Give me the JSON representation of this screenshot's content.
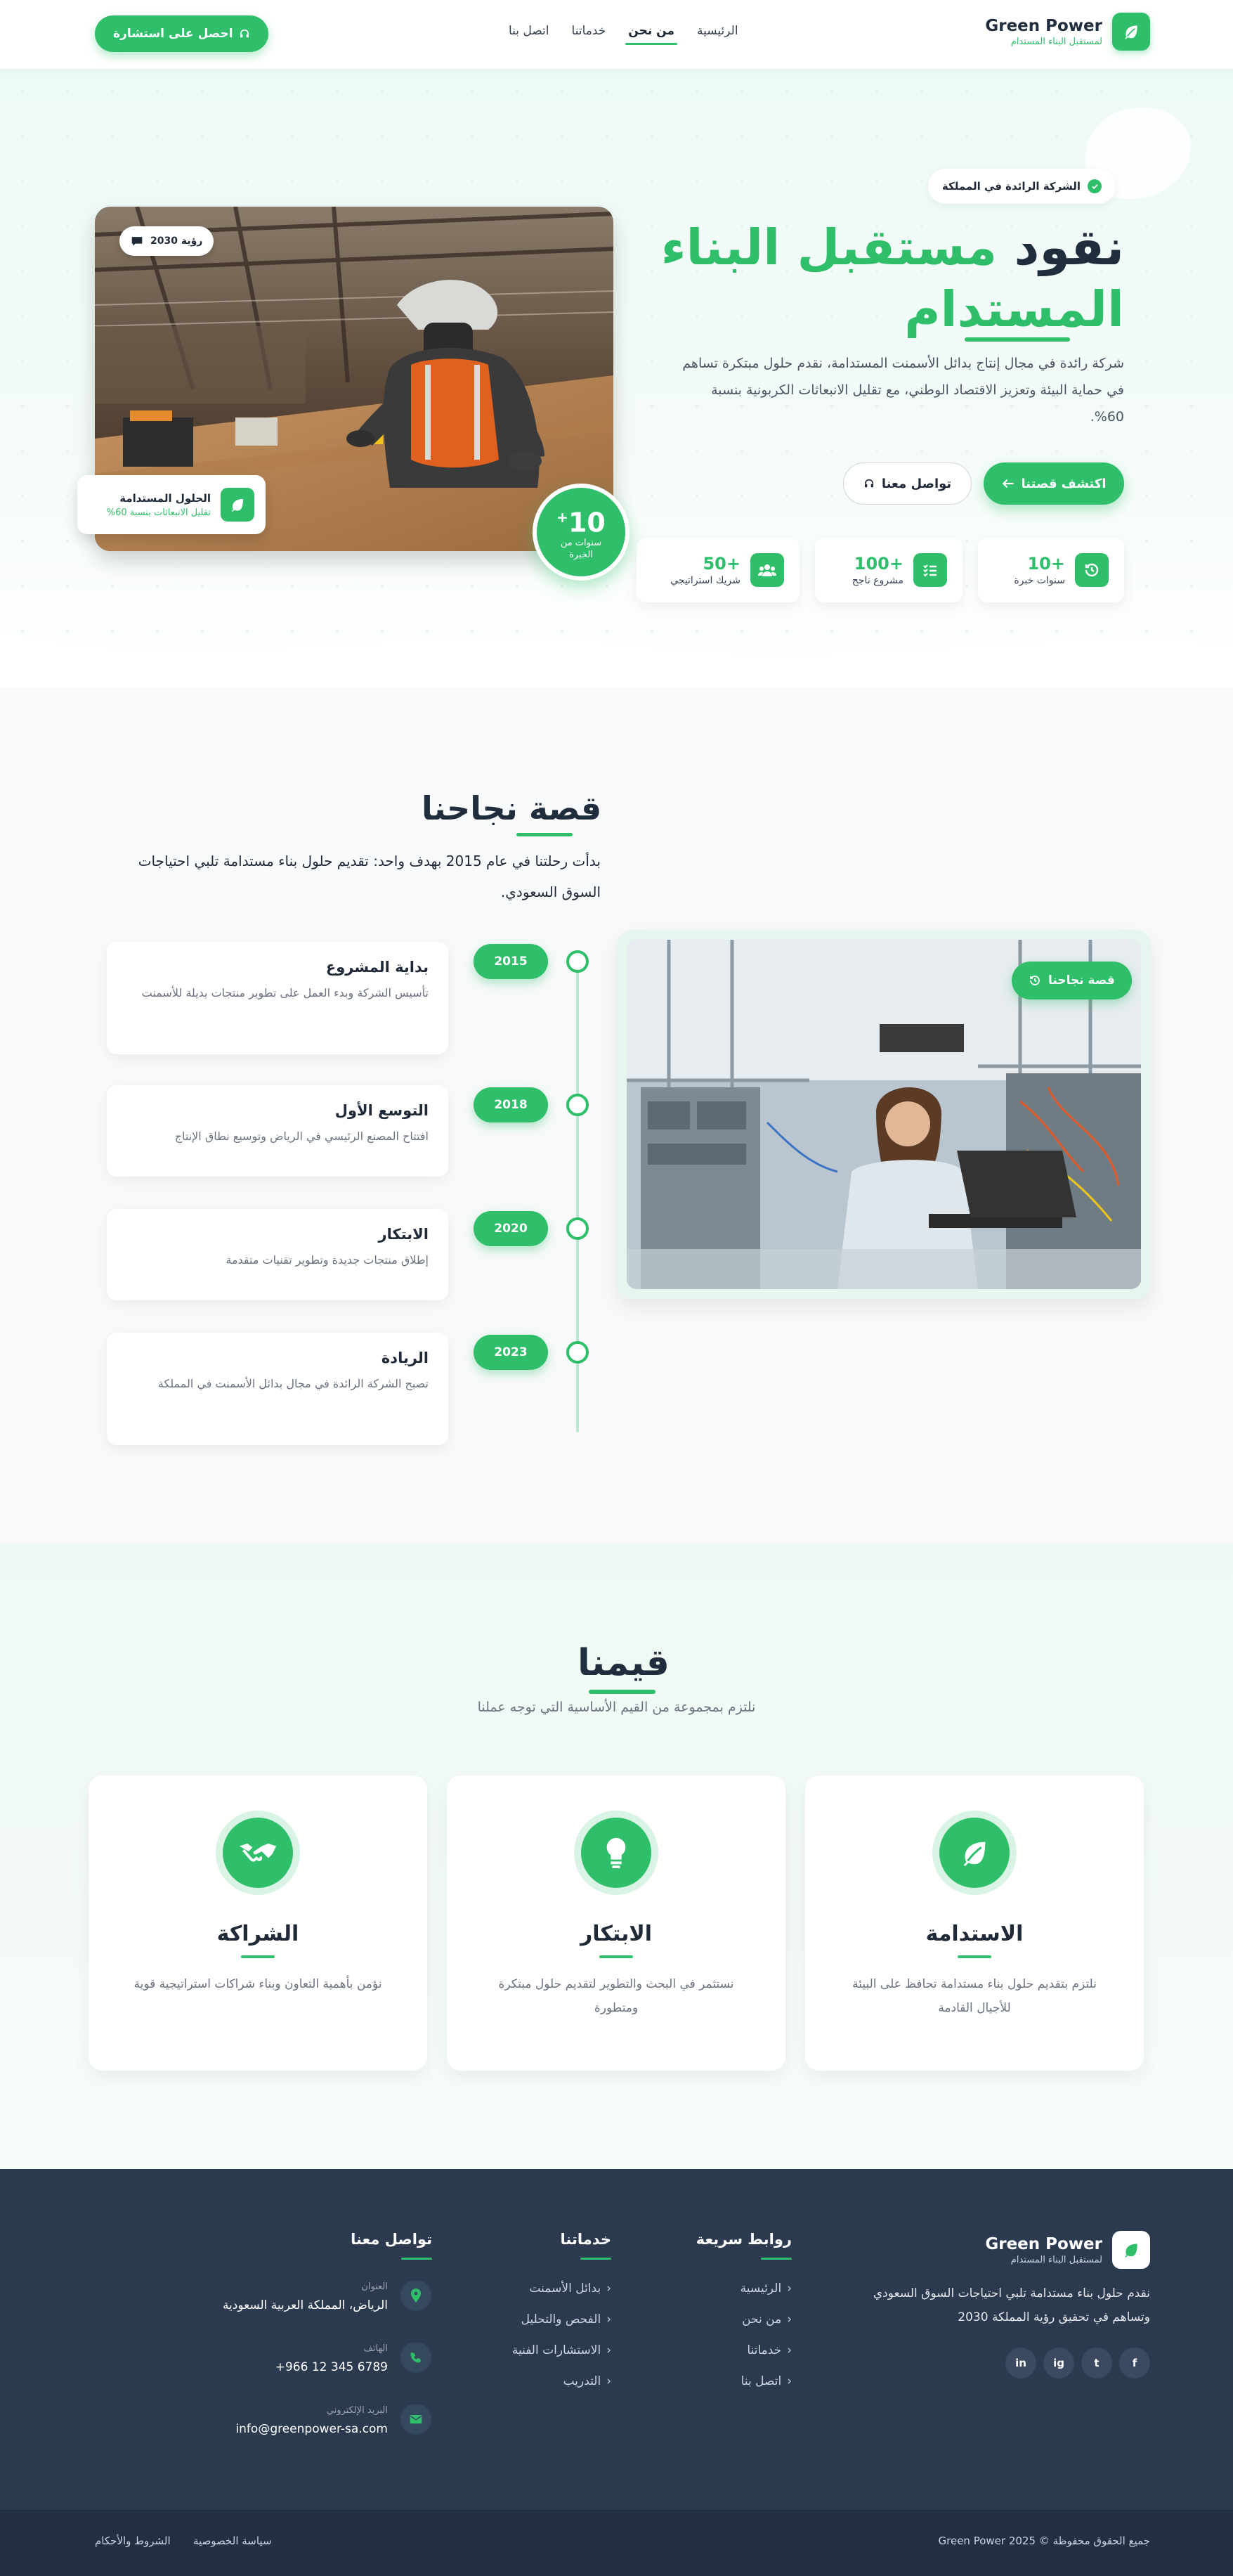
{
  "brand": {
    "name": "Green Power",
    "tagline": "لمستقبل البناء المستدام"
  },
  "nav": {
    "links": [
      "الرئيسية",
      "من نحن",
      "خدماتنا",
      "اتصل بنا"
    ],
    "active_index": 1,
    "cta": "احصل على استشارة"
  },
  "hero": {
    "badge": "الشركة الرائدة في المملكة",
    "title_line1_dark": "نقود",
    "title_line1_green": "مستقبل البناء",
    "title_line2_green": "المستدام",
    "description": "شركة رائدة في مجال إنتاج بدائل الأسمنت المستدامة، نقدم حلول مبتكرة تساهم في حماية البيئة وتعزيز الاقتصاد الوطني، مع تقليل الانبعاثات الكربونية بنسبة 60%.",
    "btn_primary": "اكتشف قصتنا",
    "btn_secondary": "تواصل معنا",
    "stats": [
      {
        "num": "+10",
        "label": "سنوات خبرة",
        "icon": "history-icon"
      },
      {
        "num": "+100",
        "label": "مشروع ناجح",
        "icon": "tasks-icon"
      },
      {
        "num": "+50",
        "label": "شريك استراتيجي",
        "icon": "users-icon"
      }
    ],
    "image_tag": "رؤية 2030",
    "mini_card": {
      "title": "الحلول المستدامة",
      "sub": "تقليل الانبعاثات بنسبة 60%"
    },
    "years_badge": {
      "num": "10",
      "sup": "+",
      "label": "سنوات من الخبرة"
    }
  },
  "story": {
    "title": "قصة نجاحنا",
    "description": "بدأت رحلتنا في عام 2015 بهدف واحد: تقديم حلول بناء مستدامة تلبي احتياجات السوق السعودي.",
    "image_tag": "قصة نجاحنا",
    "timeline": [
      {
        "year": "2015",
        "title": "بداية المشروع",
        "text": "تأسيس الشركة وبدء العمل على تطوير منتجات بديلة للأسمنت"
      },
      {
        "year": "2018",
        "title": "التوسع الأول",
        "text": "افتتاح المصنع الرئيسي في الرياض وتوسيع نطاق الإنتاج"
      },
      {
        "year": "2020",
        "title": "الابتكار",
        "text": "إطلاق منتجات جديدة وتطوير تقنيات متقدمة"
      },
      {
        "year": "2023",
        "title": "الريادة",
        "text": "تصبح الشركة الرائدة في مجال بدائل الأسمنت في المملكة"
      }
    ]
  },
  "values": {
    "title": "قيمنا",
    "subtitle": "نلتزم بمجموعة من القيم الأساسية التي توجه عملنا",
    "cards": [
      {
        "title": "الاستدامة",
        "text": "نلتزم بتقديم حلول بناء مستدامة تحافظ على البيئة للأجيال القادمة",
        "icon": "leaf-icon"
      },
      {
        "title": "الابتكار",
        "text": "نستثمر في البحث والتطوير لتقديم حلول مبتكرة ومتطورة",
        "icon": "lightbulb-icon"
      },
      {
        "title": "الشراكة",
        "text": "نؤمن بأهمية التعاون وبناء شراكات استراتيجية قوية",
        "icon": "handshake-icon"
      }
    ]
  },
  "footer": {
    "brand_name": "Green Power",
    "brand_tag": "لمستقبل البناء المستدام",
    "description": "نقدم حلول بناء مستدامة تلبي احتياجات السوق السعودي وتساهم في تحقيق رؤية المملكة 2030",
    "social": [
      "f",
      "t",
      "ig",
      "in"
    ],
    "quick_links": {
      "title": "روابط سريعة",
      "items": [
        "الرئيسية",
        "من نحن",
        "خدماتنا",
        "اتصل بنا"
      ]
    },
    "services": {
      "title": "خدماتنا",
      "items": [
        "بدائل الأسمنت",
        "الفحص والتحليل",
        "الاستشارات الفنية",
        "التدريب"
      ]
    },
    "contact": {
      "title": "تواصل معنا",
      "address_label": "العنوان",
      "address": "الرياض، المملكة العربية السعودية",
      "phone_label": "الهاتف",
      "phone": "+966 12 345 6789",
      "email_label": "البريد الإلكتروني",
      "email": "info@greenpower-sa.com"
    },
    "copyright": "جميع الحقوق محفوظة © 2025 Green Power",
    "privacy": "سياسة الخصوصية",
    "terms": "الشروط والأحكام"
  },
  "colors": {
    "accent": "#2fbf6a",
    "dark": "#1f2d3d",
    "footer_bg": "#2c3a4f"
  }
}
